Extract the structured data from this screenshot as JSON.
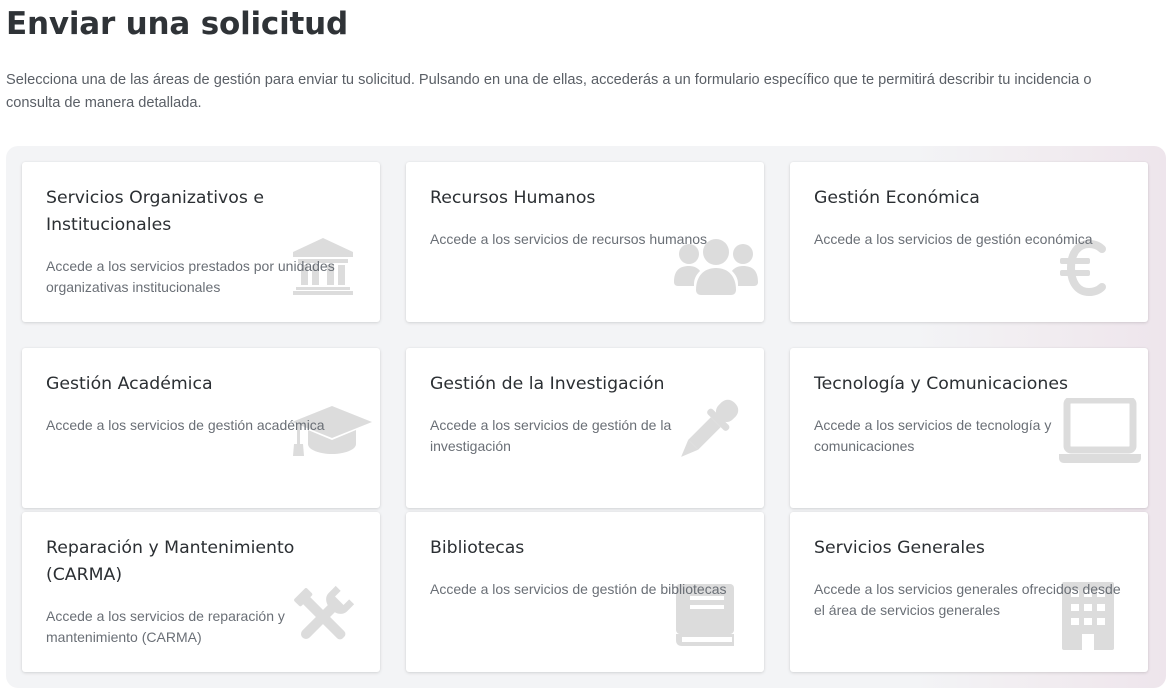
{
  "page": {
    "title": "Enviar una solicitud",
    "intro": "Selecciona una de las áreas de gestión para enviar tu solicitud. Pulsando en una de ellas, accederás a un formulario específico que te permitirá describir tu incidencia o consulta de manera detallada."
  },
  "cards": [
    {
      "title": "Servicios Organizativos e Institucionales",
      "description": "Accede a los servicios prestados por unidades organizativas institucionales",
      "icon": "institution-icon"
    },
    {
      "title": "Recursos Humanos",
      "description": "Accede a los servicios de recursos humanos",
      "icon": "users-icon"
    },
    {
      "title": "Gestión Económica",
      "description": "Accede a los servicios de gestión económica",
      "icon": "euro-icon"
    },
    {
      "title": "Gestión Académica",
      "description": "Accede a los servicios de gestión académica",
      "icon": "graduation-cap-icon"
    },
    {
      "title": "Gestión de la Investigación",
      "description": "Accede a los servicios de gestión de la investigación",
      "icon": "eyedropper-icon"
    },
    {
      "title": "Tecnología y Comunicaciones",
      "description": "Accede a los servicios de tecnología y comunicaciones",
      "icon": "laptop-icon"
    },
    {
      "title": "Reparación y Mantenimiento (CARMA)",
      "description": "Accede a los servicios de reparación y mantenimiento (CARMA)",
      "icon": "tools-icon"
    },
    {
      "title": "Bibliotecas",
      "description": "Accede a los servicios de gestión de bibliotecas",
      "icon": "book-icon"
    },
    {
      "title": "Servicios Generales",
      "description": "Accede a los servicios generales ofrecidos desde el área de servicios generales",
      "icon": "building-icon"
    }
  ],
  "colors": {
    "icon": "#dcdcdc",
    "title": "#2b2f33",
    "description": "#6a6f76",
    "panel_background": "#f3f4f6"
  }
}
